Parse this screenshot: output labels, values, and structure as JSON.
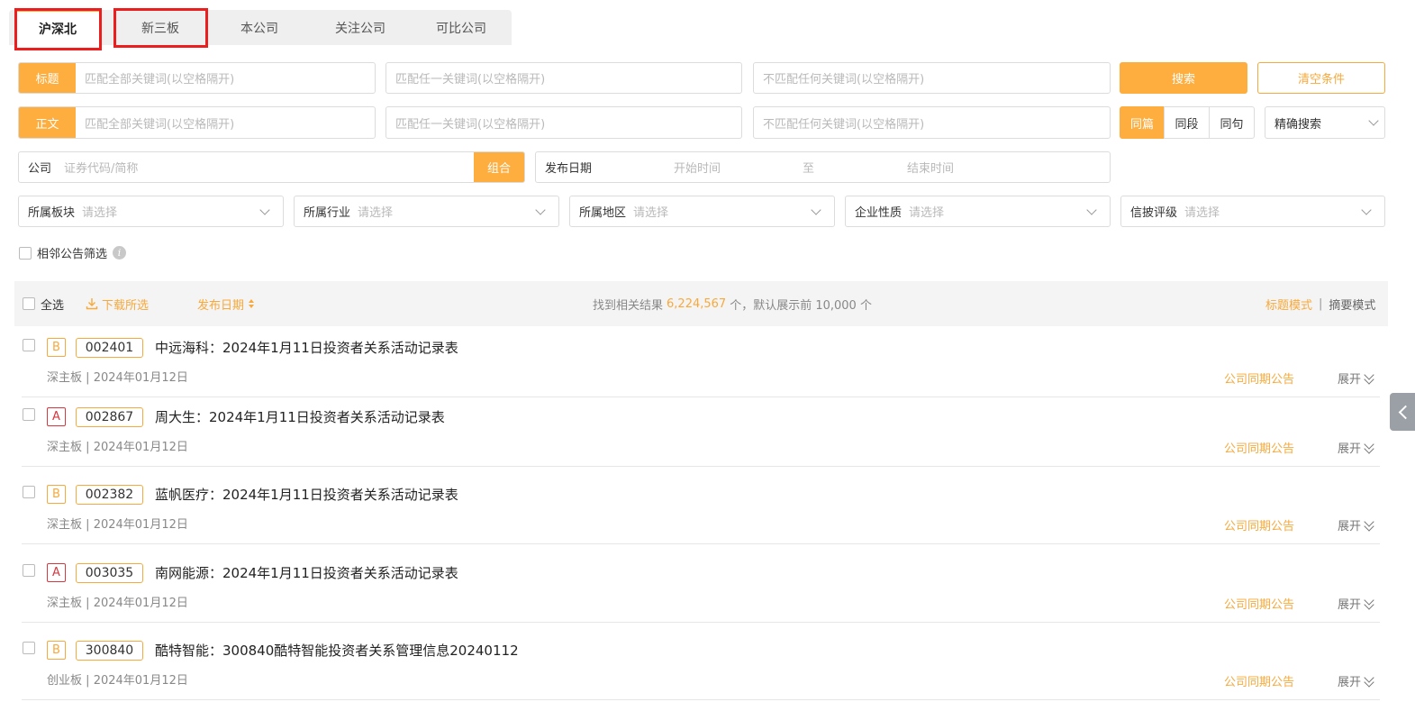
{
  "tabs": [
    {
      "label": "沪深北",
      "active": true
    },
    {
      "label": "新三板",
      "active": false
    },
    {
      "label": "本公司",
      "active": false
    },
    {
      "label": "关注公司",
      "active": false
    },
    {
      "label": "可比公司",
      "active": false
    }
  ],
  "search": {
    "title_tag": "标题",
    "body_tag": "正文",
    "all_keywords_ph": "匹配全部关键词(以空格隔开)",
    "any_keyword_ph": "匹配任一关键词(以空格隔开)",
    "none_keyword_ph": "不匹配任何关键词(以空格隔开)",
    "search_btn": "搜索",
    "clear_btn": "清空条件",
    "scope": [
      "同篇",
      "同段",
      "同句"
    ],
    "precision": "精确搜索",
    "company_label": "公司",
    "company_ph": "证券代码/简称",
    "combo_btn": "组合",
    "date_label": "发布日期",
    "start_ph": "开始时间",
    "to": "至",
    "end_ph": "结束时间"
  },
  "filters": [
    {
      "label": "所属板块",
      "placeholder": "请选择"
    },
    {
      "label": "所属行业",
      "placeholder": "请选择"
    },
    {
      "label": "所属地区",
      "placeholder": "请选择"
    },
    {
      "label": "企业性质",
      "placeholder": "请选择"
    },
    {
      "label": "信披评级",
      "placeholder": "请选择"
    }
  ],
  "adjacent_filter": "相邻公告筛选",
  "result_bar": {
    "select_all": "全选",
    "download": "下载所选",
    "sort": "发布日期",
    "found_prefix": "找到相关结果",
    "count": "6,224,567",
    "found_suffix": "个，默认展示前 10,000 个",
    "mode_title": "标题模式",
    "separator": "|",
    "mode_summary": "摘要模式"
  },
  "results": [
    {
      "grade": "B",
      "code": "002401",
      "title": "中远海科：2024年1月11日投资者关系活动记录表",
      "board": "深主板",
      "date": "2024年01月12日"
    },
    {
      "grade": "A",
      "code": "002867",
      "title": "周大生：2024年1月11日投资者关系活动记录表",
      "board": "深主板",
      "date": "2024年01月12日"
    },
    {
      "grade": "B",
      "code": "002382",
      "title": "蓝帆医疗：2024年1月11日投资者关系活动记录表",
      "board": "深主板",
      "date": "2024年01月12日"
    },
    {
      "grade": "A",
      "code": "003035",
      "title": "南网能源：2024年1月11日投资者关系活动记录表",
      "board": "深主板",
      "date": "2024年01月12日"
    },
    {
      "grade": "B",
      "code": "300840",
      "title": "酷特智能：300840酷特智能投资者关系管理信息20240112",
      "board": "创业板",
      "date": "2024年01月12日"
    }
  ],
  "row_labels": {
    "sync": "公司同期公告",
    "expand": "展开",
    "sep": "|"
  },
  "colors": {
    "accent": "#fdae3f",
    "grade_a": "#d9363e",
    "grade_b": "#f7a93b",
    "highlight": "#ee1d1d"
  }
}
